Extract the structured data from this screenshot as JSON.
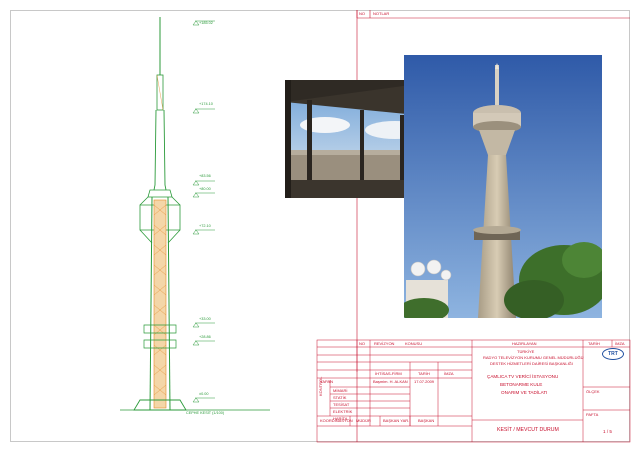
{
  "notes_header": {
    "no": "NO",
    "label": "NOTLAR"
  },
  "revisions_header": {
    "no": "NO",
    "date": "REVİZYON",
    "subject": "KONUSU"
  },
  "levels": [
    "+185.02",
    "+174.10",
    "+83.56",
    "+80.00",
    "+72.10",
    "+33.00",
    "+28.86",
    "±0.00"
  ],
  "base_label": "CEPHE KESİT (1/100)",
  "title_block": {
    "prepared_header": "HAZIRLAYAN",
    "date_header": "TARİH",
    "sign_header": "İMZA",
    "discipline_header": "İHTİSAS-FİRM",
    "name_header": "TARİH",
    "sign2_header": "İMZA",
    "prepared_by_label": "YAPAN",
    "drawn_name": "Başmim. H. ALKAN",
    "drawn_date": "17.07.2009",
    "disciplines": [
      "MİMARİ",
      "STATİK",
      "TESİSAT",
      "ELEKTRİK",
      "HARİTA"
    ],
    "control_label": "KONTROL",
    "coordination": "KOORDİNASYON",
    "manager": "MÜDÜR",
    "deputy": "BAŞKAN YAR.",
    "president": "BAŞKAN",
    "country": "TÜRKİYE",
    "institution_1": "RADYO TELEVİZYON KURUMU GENEL MÜDÜRLÜĞÜ",
    "institution_2": "DESTEK HİZMETLERİ DAİRESİ BAŞKANLIĞI",
    "project_1": "ÇAMLICA TV VERİCİ İSTASYONU",
    "project_2": "BETONARME KULE",
    "project_3": "ONARIM VE TADİLATI",
    "sheet_title": "KESİT / MEVCUT DURUM",
    "scale_label": "ÖLÇEK",
    "paftа_label": "PAFTA",
    "page": "1 / 5",
    "logo": "TRT"
  },
  "colors": {
    "red": "#c8102e",
    "green": "#2b9a3a",
    "orange": "#e58a2a"
  }
}
